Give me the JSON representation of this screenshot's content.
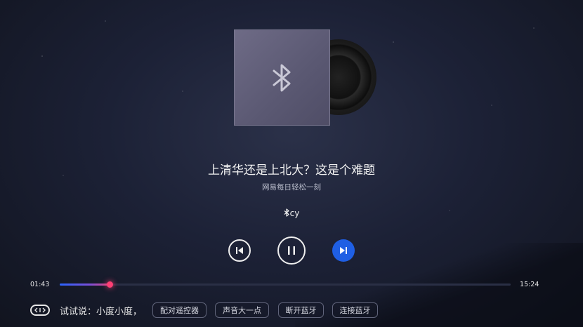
{
  "player": {
    "title": "上清华还是上北大？这是个难题",
    "album": "网易每日轻松一刻",
    "device_name": "cy",
    "current_time": "01:43",
    "total_time": "15:24",
    "progress": 0.11
  },
  "icons": {
    "cover": "bluetooth-icon",
    "device": "bluetooth-icon",
    "previous": "skip-previous-icon",
    "play_pause": "pause-icon",
    "next": "skip-next-icon",
    "voice_hint": "remote-icon"
  },
  "colors": {
    "accent": "#1f5fe4",
    "progress_end": "#ff3f74"
  },
  "voice_hint": {
    "prefix": "试试说：小度小度，",
    "suggestions": [
      "配对遥控器",
      "声音大一点",
      "断开蓝牙",
      "连接蓝牙"
    ]
  }
}
